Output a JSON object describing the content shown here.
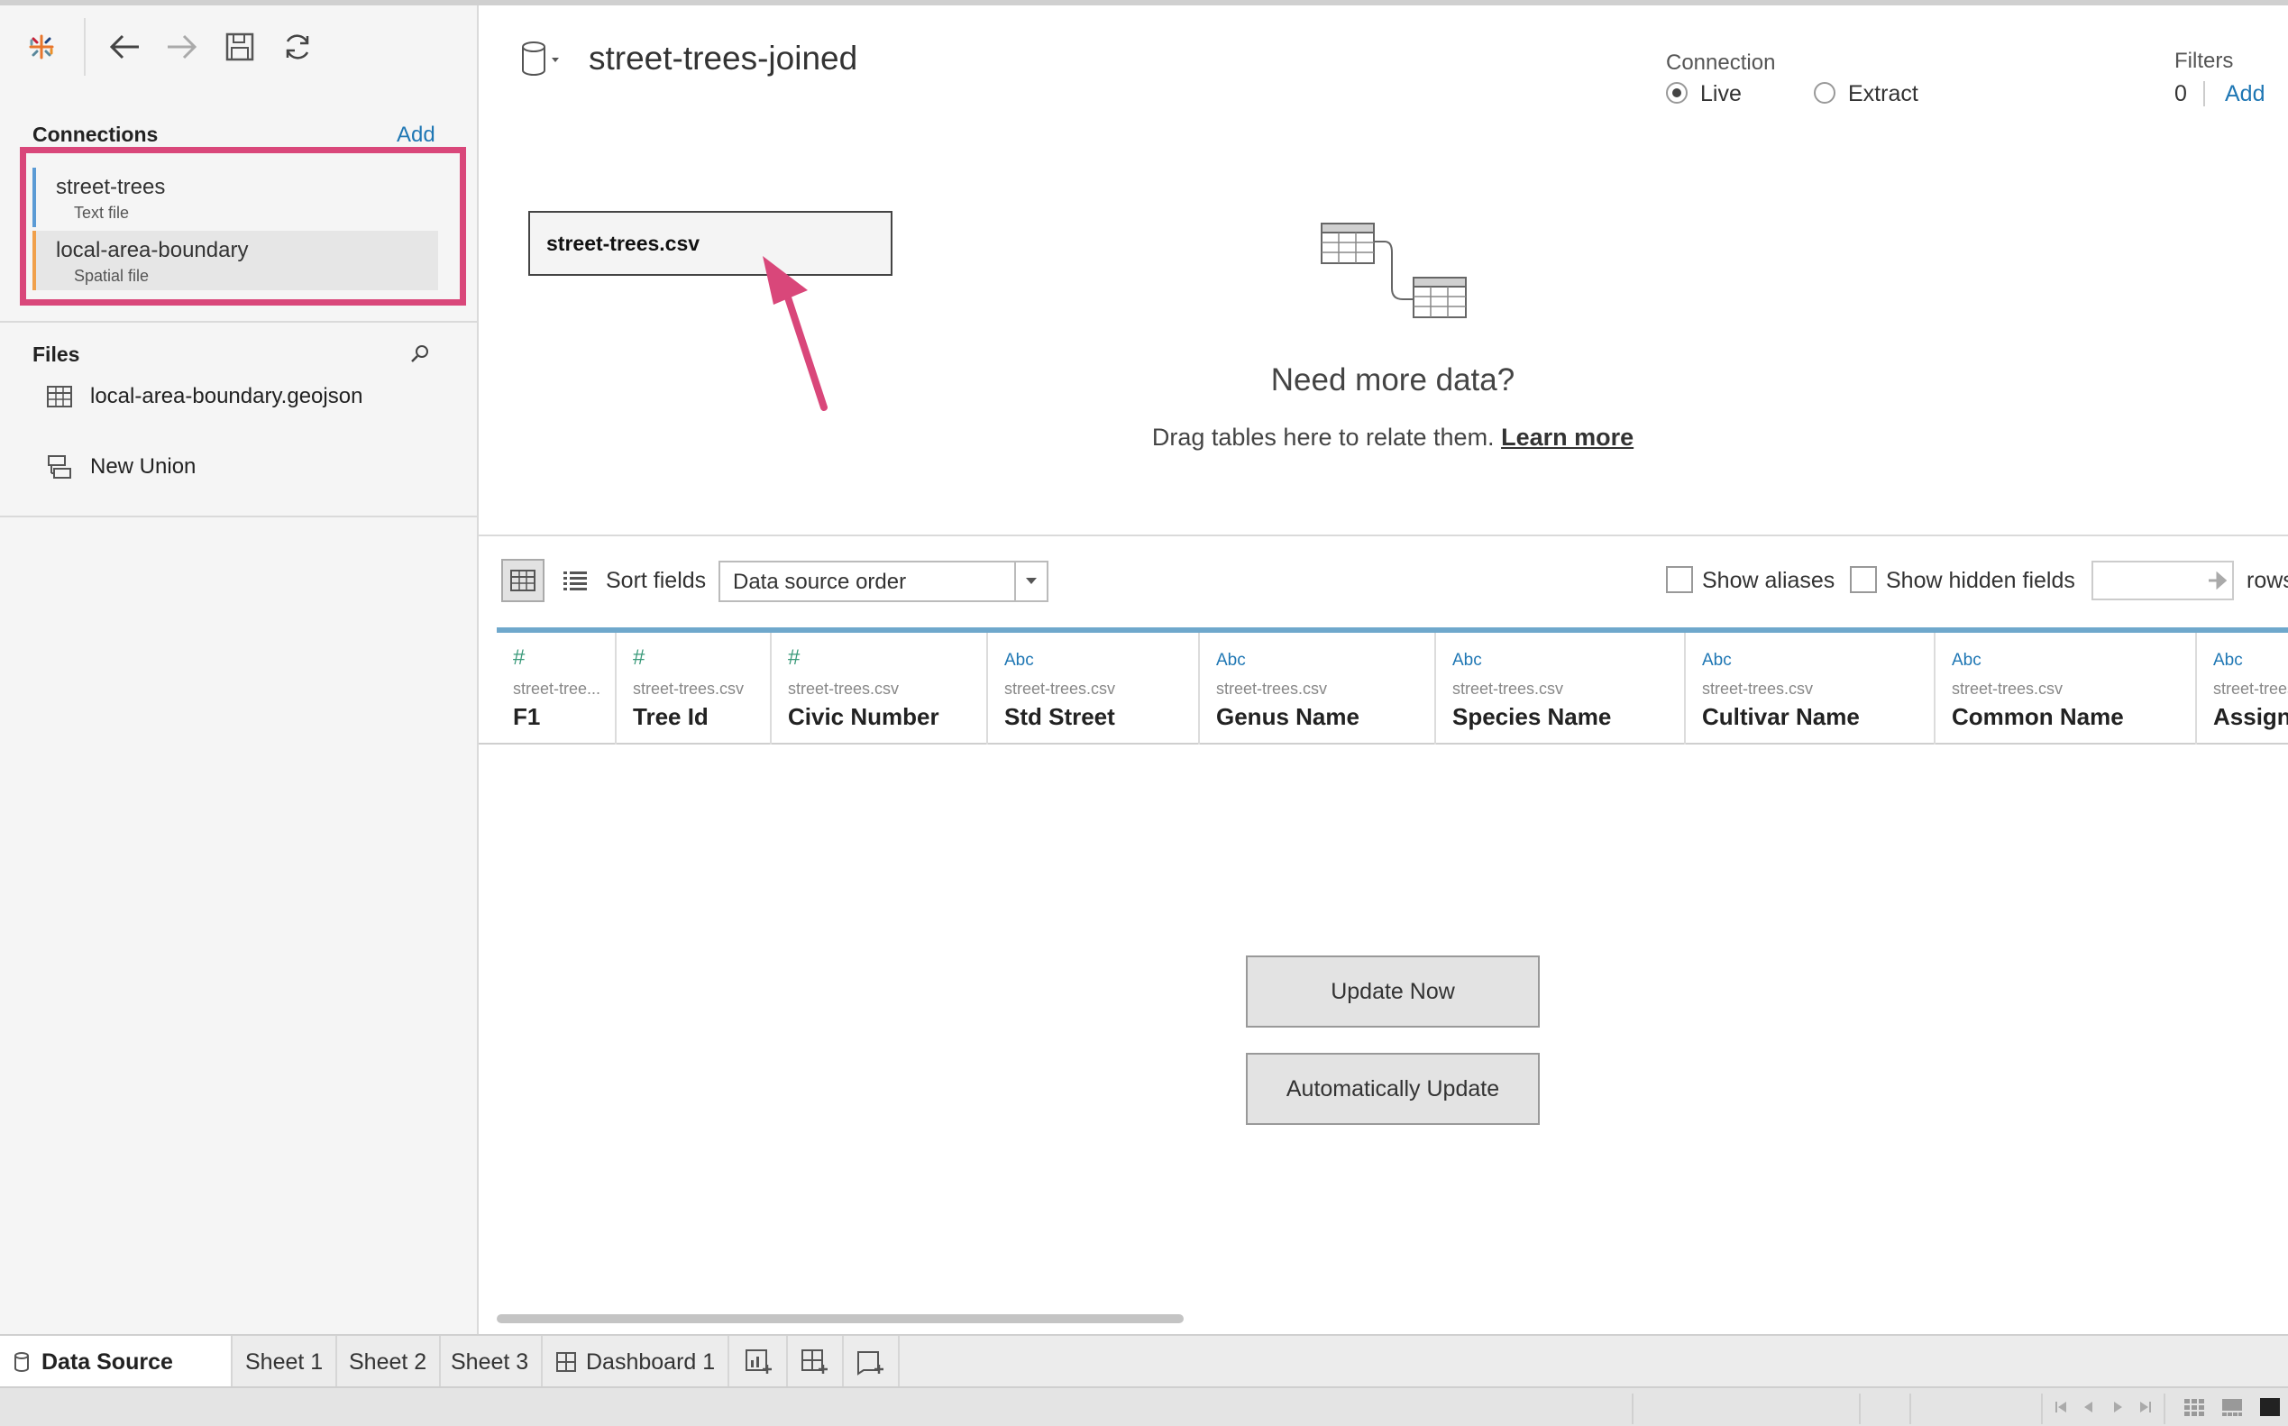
{
  "app": {
    "toolbar": {
      "logo_icon": "tableau-logo-icon",
      "back_icon": "arrow-left-icon",
      "forward_icon": "arrow-right-icon",
      "save_icon": "save-icon",
      "refresh_icon": "refresh-icon"
    }
  },
  "sidebar": {
    "connections_title": "Connections",
    "connections_add": "Add",
    "connections": [
      {
        "name": "street-trees",
        "type": "Text file",
        "color": "#5b9bd5"
      },
      {
        "name": "local-area-boundary",
        "type": "Spatial file",
        "color": "#f0a04b"
      }
    ],
    "files_title": "Files",
    "files": [
      {
        "name": "local-area-boundary.geojson",
        "icon": "table-icon"
      },
      {
        "name": "New Union",
        "icon": "union-icon"
      }
    ]
  },
  "datasource": {
    "title": "street-trees-joined",
    "connection_label": "Connection",
    "live_label": "Live",
    "extract_label": "Extract",
    "selected_connection": "Live",
    "filters_label": "Filters",
    "filters_count": "0",
    "filters_add": "Add",
    "table_name": "street-trees.csv",
    "need_more_title": "Need more data?",
    "drag_text": "Drag tables here to relate them.",
    "learn_more": "Learn more",
    "highlight_color": "#d9477a"
  },
  "grid_toolbar": {
    "sort_label": "Sort fields",
    "sort_value": "Data source order",
    "show_aliases": "Show aliases",
    "show_hidden": "Show hidden fields",
    "rows_label": "rows"
  },
  "columns": [
    {
      "type": "#",
      "source": "street-tree...",
      "name": "F1"
    },
    {
      "type": "#",
      "source": "street-trees.csv",
      "name": "Tree Id"
    },
    {
      "type": "#",
      "source": "street-trees.csv",
      "name": "Civic Number"
    },
    {
      "type": "Abc",
      "source": "street-trees.csv",
      "name": "Std Street"
    },
    {
      "type": "Abc",
      "source": "street-trees.csv",
      "name": "Genus Name"
    },
    {
      "type": "Abc",
      "source": "street-trees.csv",
      "name": "Species Name"
    },
    {
      "type": "Abc",
      "source": "street-trees.csv",
      "name": "Cultivar Name"
    },
    {
      "type": "Abc",
      "source": "street-trees.csv",
      "name": "Common Name"
    },
    {
      "type": "Abc",
      "source": "street-trees",
      "name": "Assigne"
    }
  ],
  "buttons": {
    "update_now": "Update Now",
    "auto_update": "Automatically Update"
  },
  "tabs": {
    "data_source": "Data Source",
    "sheets": [
      "Sheet 1",
      "Sheet 2",
      "Sheet 3"
    ],
    "dashboard": "Dashboard 1",
    "new_sheet_icon": "new-worksheet-icon",
    "new_dashboard_icon": "new-dashboard-icon",
    "new_story_icon": "new-story-icon"
  }
}
